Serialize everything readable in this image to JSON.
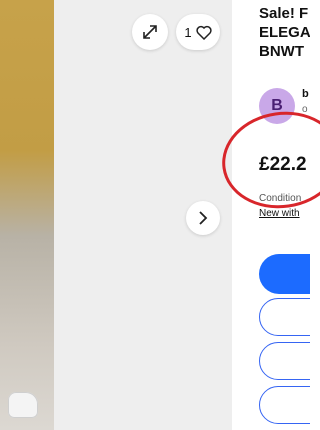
{
  "product": {
    "title_lines": [
      "Sale! F",
      "ELEGA",
      "BNWT"
    ],
    "price": "£22.2",
    "condition_label": "Condition",
    "condition_value": "New with"
  },
  "seller": {
    "avatar_letter": "B",
    "name": "b",
    "sub": "o"
  },
  "gallery": {
    "favorite_count": "1"
  },
  "colors": {
    "accent": "#3665f3",
    "primary_button": "#1c6bff",
    "annotation": "#d8262b"
  }
}
